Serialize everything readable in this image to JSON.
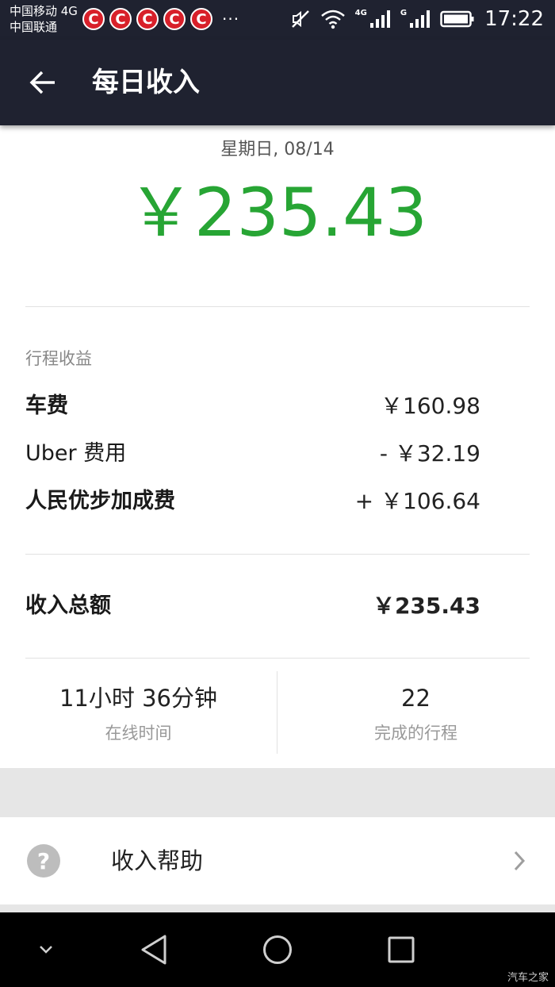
{
  "status_bar": {
    "carrier_1": "中国移动 4G",
    "carrier_2": "中国联通",
    "notif_letter": "C",
    "more": "···",
    "net_1": "4G",
    "net_2": "G",
    "time": "17:22"
  },
  "app_bar": {
    "title": "每日收入",
    "back_icon": "arrow-left-icon"
  },
  "summary": {
    "date": "星期日, 08/14",
    "total": "￥235.43",
    "total_color": "#27a534"
  },
  "trip_earnings": {
    "section_label": "行程收益",
    "rows": [
      {
        "label": "车费",
        "value": "￥160.98"
      },
      {
        "label": "Uber 费用",
        "value": "- ￥32.19"
      },
      {
        "label": "人民优步加成费",
        "value": "+ ￥106.64"
      }
    ]
  },
  "total_row": {
    "label": "收入总额",
    "value": "￥235.43"
  },
  "stats": {
    "online": {
      "value": "11小时 36分钟",
      "caption": "在线时间"
    },
    "trips": {
      "value": "22",
      "caption": "完成的行程"
    }
  },
  "help": {
    "label": "收入帮助",
    "icon": "question-icon",
    "chevron": "chevron-right-icon"
  },
  "nav_bar": {
    "down": "chevron-down-icon",
    "back": "triangle-back-icon",
    "home": "circle-home-icon",
    "recents": "square-recents-icon"
  },
  "watermark": "汽车之家"
}
